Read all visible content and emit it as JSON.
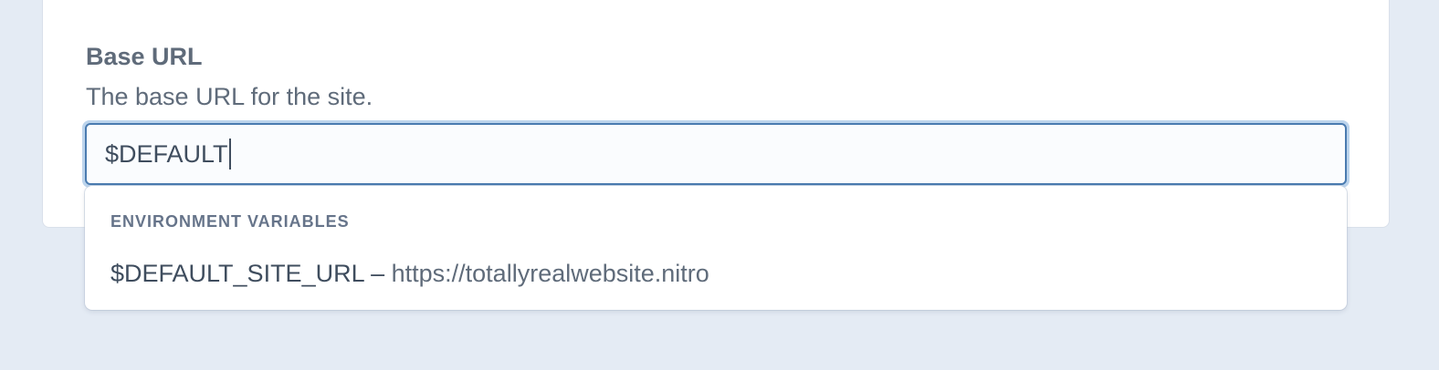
{
  "field": {
    "label": "Base URL",
    "instructions": "The base URL for the site.",
    "value": "$DEFAULT"
  },
  "dropdown": {
    "heading": "ENVIRONMENT VARIABLES",
    "options": [
      {
        "name": "$DEFAULT_SITE_URL",
        "separator": " – ",
        "value": "https://totallyrealwebsite.nitro"
      }
    ]
  }
}
